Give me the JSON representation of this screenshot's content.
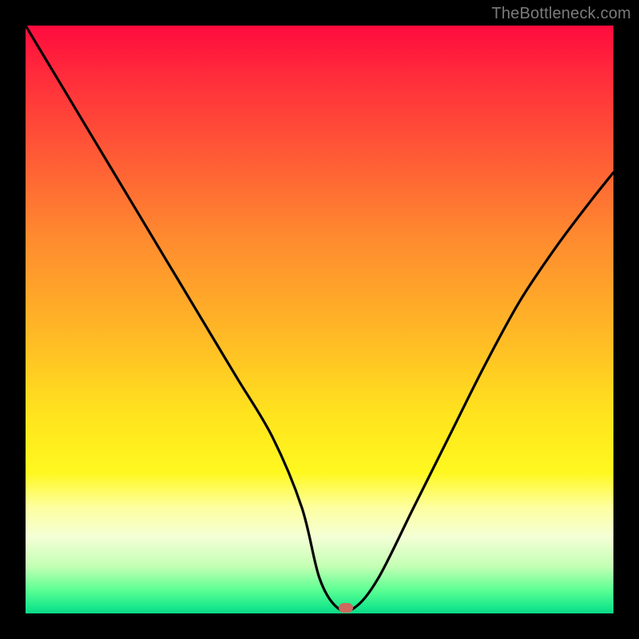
{
  "watermark": "TheBottleneck.com",
  "colors": {
    "frame_border": "#000000",
    "curve": "#000000",
    "marker": "#cc6a5f"
  },
  "chart_data": {
    "type": "line",
    "title": "",
    "xlabel": "",
    "ylabel": "",
    "xlim": [
      0,
      100
    ],
    "ylim": [
      0,
      100
    ],
    "grid": false,
    "legend": false,
    "annotations": [
      {
        "text": "TheBottleneck.com",
        "position": "top-right"
      }
    ],
    "series": [
      {
        "name": "bottleneck-curve",
        "x": [
          0,
          6,
          12,
          18,
          24,
          30,
          36,
          42,
          47,
          50,
          53,
          56,
          60,
          66,
          72,
          78,
          84,
          90,
          96,
          100
        ],
        "y": [
          100,
          90,
          80,
          70,
          60,
          50,
          40,
          30,
          18,
          6,
          1,
          1,
          6,
          18,
          30,
          42,
          53,
          62,
          70,
          75
        ]
      }
    ],
    "marker": {
      "x": 54.5,
      "y": 1
    }
  }
}
